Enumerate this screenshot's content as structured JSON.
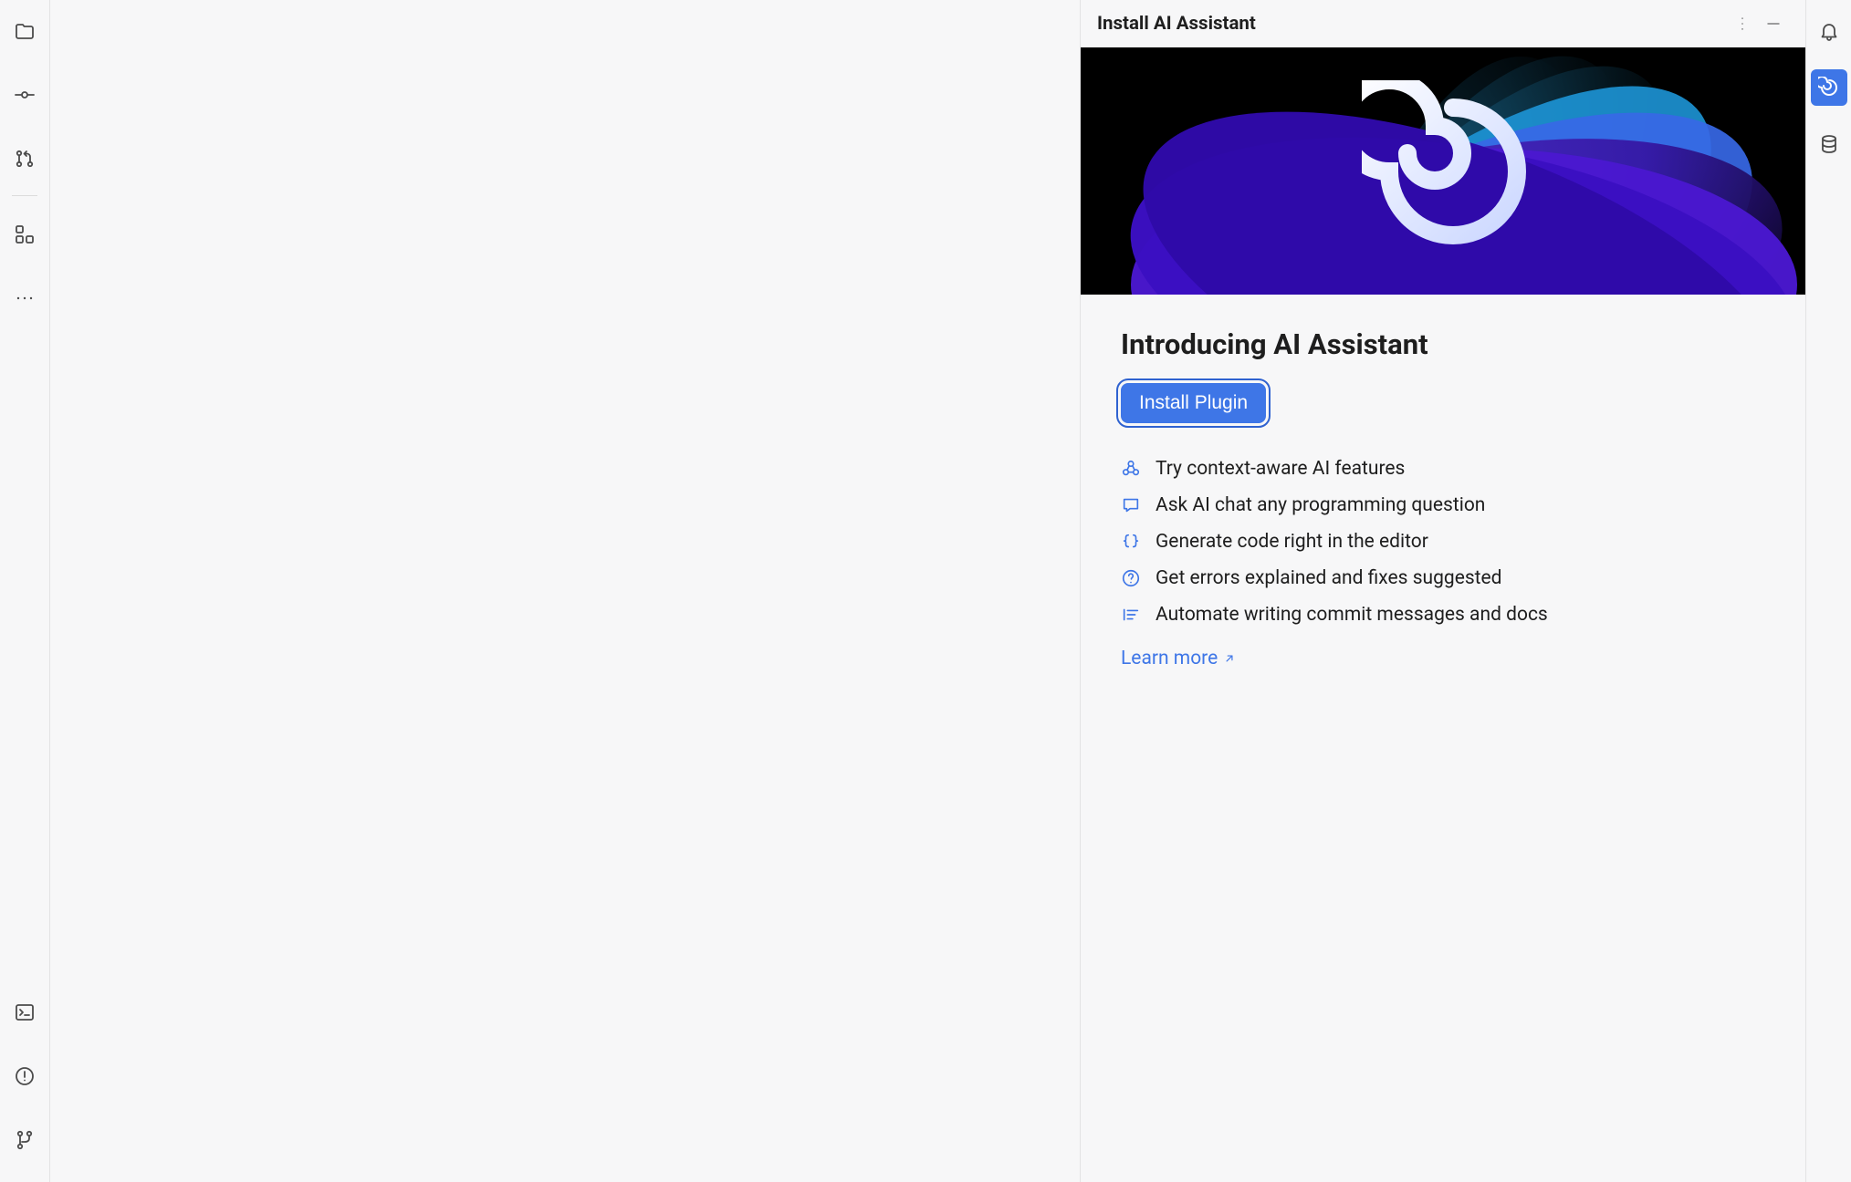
{
  "left_strip": {
    "top": [
      {
        "name": "project-icon"
      },
      {
        "name": "commit-icon"
      },
      {
        "name": "pull-requests-icon"
      }
    ],
    "after_divider": [
      {
        "name": "structure-icon"
      },
      {
        "name": "more-icon"
      }
    ],
    "bottom": [
      {
        "name": "terminal-icon"
      },
      {
        "name": "problems-icon"
      },
      {
        "name": "git-icon"
      }
    ]
  },
  "panel": {
    "title": "Install AI Assistant",
    "intro_heading": "Introducing AI Assistant",
    "install_button": "Install Plugin",
    "features": [
      {
        "icon": "context-icon",
        "text": "Try context-aware AI features"
      },
      {
        "icon": "chat-icon",
        "text": "Ask AI chat any programming question"
      },
      {
        "icon": "code-icon",
        "text": "Generate code right in the editor"
      },
      {
        "icon": "help-icon",
        "text": "Get errors explained and fixes suggested"
      },
      {
        "icon": "automate-icon",
        "text": "Automate writing commit messages and docs"
      }
    ],
    "learn_more": "Learn more"
  },
  "right_strip": {
    "items": [
      {
        "name": "notifications-icon",
        "active": false
      },
      {
        "name": "ai-assistant-icon",
        "active": true
      },
      {
        "name": "database-icon",
        "active": false
      }
    ]
  },
  "colors": {
    "accent": "#3e76e7",
    "icon_gray": "#4b4b4b",
    "border": "#e3e3e4"
  }
}
